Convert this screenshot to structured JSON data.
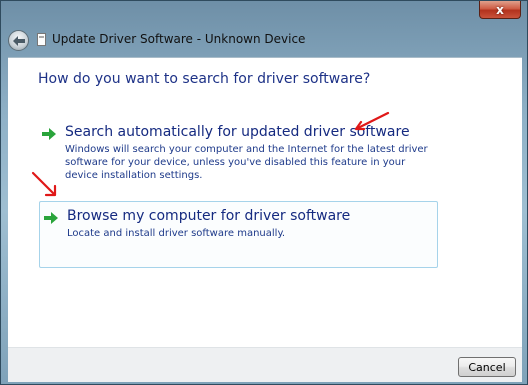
{
  "window": {
    "title": "Update Driver Software - Unknown Device",
    "close_label": "x"
  },
  "content": {
    "heading": "How do you want to search for driver software?",
    "options": [
      {
        "title": "Search automatically for updated driver software",
        "description": "Windows will search your computer and the Internet for the latest driver software for your device, unless you've disabled this feature in your device installation settings."
      },
      {
        "title": "Browse my computer for driver software",
        "description": "Locate and install driver software manually."
      }
    ]
  },
  "footer": {
    "cancel_label": "Cancel"
  },
  "colors": {
    "heading": "#1e3287",
    "link_text": "#152a80",
    "arrow_green": "#2aa43b",
    "annotation_red": "#e01818"
  },
  "icons": [
    "back-arrow-icon",
    "device-icon",
    "green-arrow-icon",
    "red-annotation-arrow"
  ]
}
